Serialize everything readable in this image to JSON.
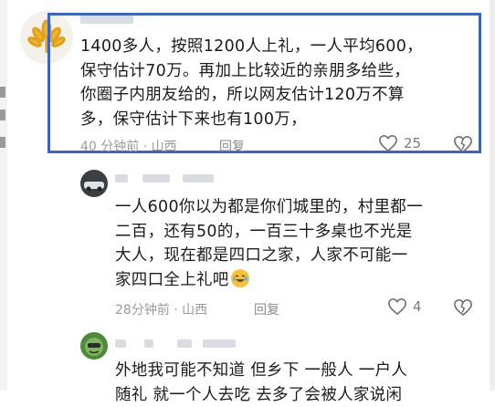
{
  "comments": [
    {
      "text_lines": [
        "1400多人，按照1200人上礼，一人平均600，",
        "保守估计70万。再加上比较近的亲朋多给些，",
        "你圈子内朋友给的，所以网友估计120万不算",
        "多，保守估计下来也有100万，"
      ],
      "meta": "40 分钟前 · 山西",
      "reply": "回复",
      "likes": "25"
    },
    {
      "text_lines": [
        "一人600你以为都是你们城里的，村里都一",
        "二百，还有50的，一百三十多桌也不光是",
        "大人，现在都是四口之家，人家不可能一",
        "家四口全上礼吧"
      ],
      "meta": "28分钟前 · 山西",
      "reply": "回复",
      "likes": "4"
    },
    {
      "text_lines": [
        "外地我可能不知道  但乡下 一般人 一户人",
        "随礼  就一个人去吃  去多了会被人家说闲"
      ]
    }
  ],
  "colors": {
    "highlight": "#3d63c9",
    "meta": "#9b9b9b"
  },
  "icons": [
    "like-icon",
    "dislike-icon",
    "laugh-emoji-icon"
  ]
}
